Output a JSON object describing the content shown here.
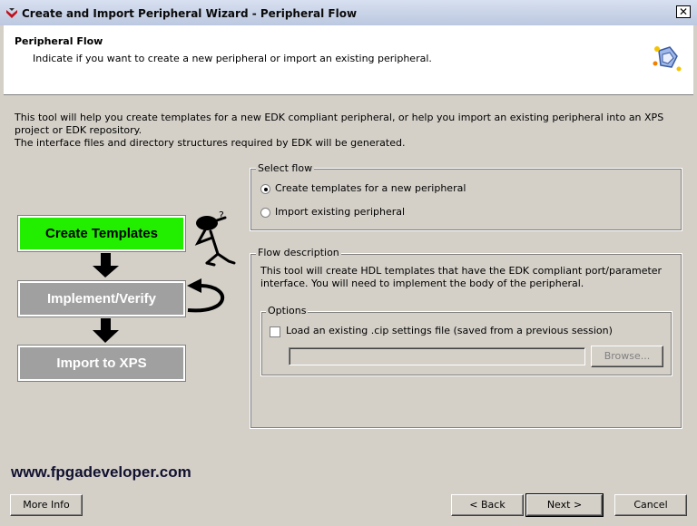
{
  "window": {
    "title": "Create and Import Peripheral Wizard - Peripheral Flow",
    "close_glyph": "✕",
    "app_icon": "xilinx-icon"
  },
  "header": {
    "title": "Peripheral Flow",
    "subtitle": "Indicate if you want to create a new peripheral or import an existing peripheral.",
    "icon": "puzzle-wizard-icon"
  },
  "intro": {
    "line1": "This tool will help you create templates for a new EDK compliant peripheral, or help you import an existing peripheral into an XPS project or EDK repository.",
    "line2": "The interface files and directory structures required by EDK will be generated."
  },
  "diagram": {
    "step1": "Create Templates",
    "step2": "Implement/Verify",
    "step3": "Import to XPS",
    "step1_color": "#22ee00",
    "step_inactive_color": "#a0a0a0"
  },
  "select_flow": {
    "legend": "Select flow",
    "option_create": "Create templates for a new peripheral",
    "option_import": "Import existing peripheral",
    "selected": "create"
  },
  "flow_description": {
    "legend": "Flow description",
    "text": "This tool will create HDL templates that have the EDK compliant port/parameter interface. You will need to implement the body of the peripheral."
  },
  "options": {
    "legend": "Options",
    "load_label": "Load an existing .cip settings file (saved from a previous session)",
    "load_checked": false,
    "path_value": "",
    "browse_label": "Browse..."
  },
  "watermark": "www.fpgadeveloper.com",
  "footer": {
    "more_info": "More Info",
    "back": "< Back",
    "next": "Next >",
    "cancel": "Cancel"
  }
}
